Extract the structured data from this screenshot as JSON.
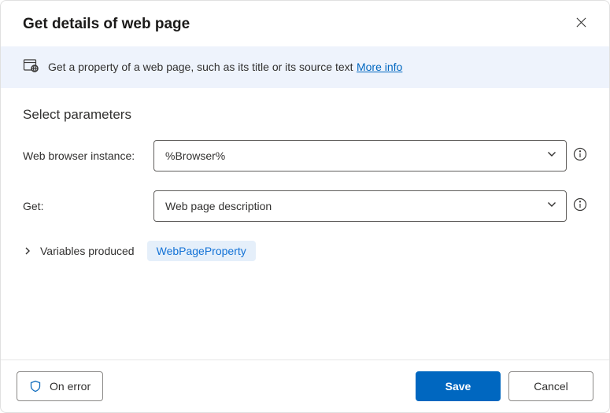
{
  "dialog": {
    "title": "Get details of web page"
  },
  "info": {
    "description": "Get a property of a web page, such as its title or its source text",
    "more_link": "More info"
  },
  "params": {
    "section_title": "Select parameters",
    "browser_label": "Web browser instance:",
    "browser_value": "%Browser%",
    "get_label": "Get:",
    "get_value": "Web page description"
  },
  "variables": {
    "label": "Variables produced",
    "chip": "WebPageProperty"
  },
  "footer": {
    "on_error": "On error",
    "save": "Save",
    "cancel": "Cancel"
  }
}
